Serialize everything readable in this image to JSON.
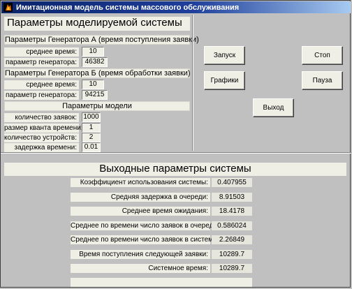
{
  "window": {
    "title": "Имитационная модель системы массового обслуживания"
  },
  "model_params": {
    "title": "Параметры моделируемой системы",
    "gen_a": {
      "header": "Параметры Генератора А (время поступления заявки)",
      "mean_label": "среднее время:",
      "mean_value": "10",
      "param_label": "параметр генератора:",
      "param_value": "46382"
    },
    "gen_b": {
      "header": "Параметры Генератора Б (время обработки заявки)",
      "mean_label": "среднее время:",
      "mean_value": "10",
      "param_label": "параметр генератора:",
      "param_value": "94215"
    },
    "model": {
      "header": "Параметры модели",
      "requests_label": "количество заявок:",
      "requests_value": "1000",
      "quantum_label": "размер кванта времени:",
      "quantum_value": "1",
      "devices_label": "количество устройств:",
      "devices_value": "2",
      "delay_label": "задержка времени:",
      "delay_value": "0.01"
    }
  },
  "buttons": {
    "start": "Запуск",
    "stop": "Стоп",
    "graphs": "Графики",
    "pause": "Пауза",
    "exit": "Выход"
  },
  "output": {
    "title": "Выходные параметры системы",
    "rows": [
      {
        "label": "Коэффициент использования системы:",
        "value": "0.407955"
      },
      {
        "label": "Средняя задержка в очереди:",
        "value": "8.91503"
      },
      {
        "label": "Среднее время ожидания:",
        "value": "18.4178"
      },
      {
        "label": "Среднее по времени число заявок в очереди:",
        "value": "0.586024"
      },
      {
        "label": "Среднее по времени число заявок в системе:",
        "value": "2.26849"
      },
      {
        "label": "Время поступления следующей заявки:",
        "value": "10289.7"
      },
      {
        "label": "Системное время:",
        "value": "10289.7"
      }
    ]
  }
}
